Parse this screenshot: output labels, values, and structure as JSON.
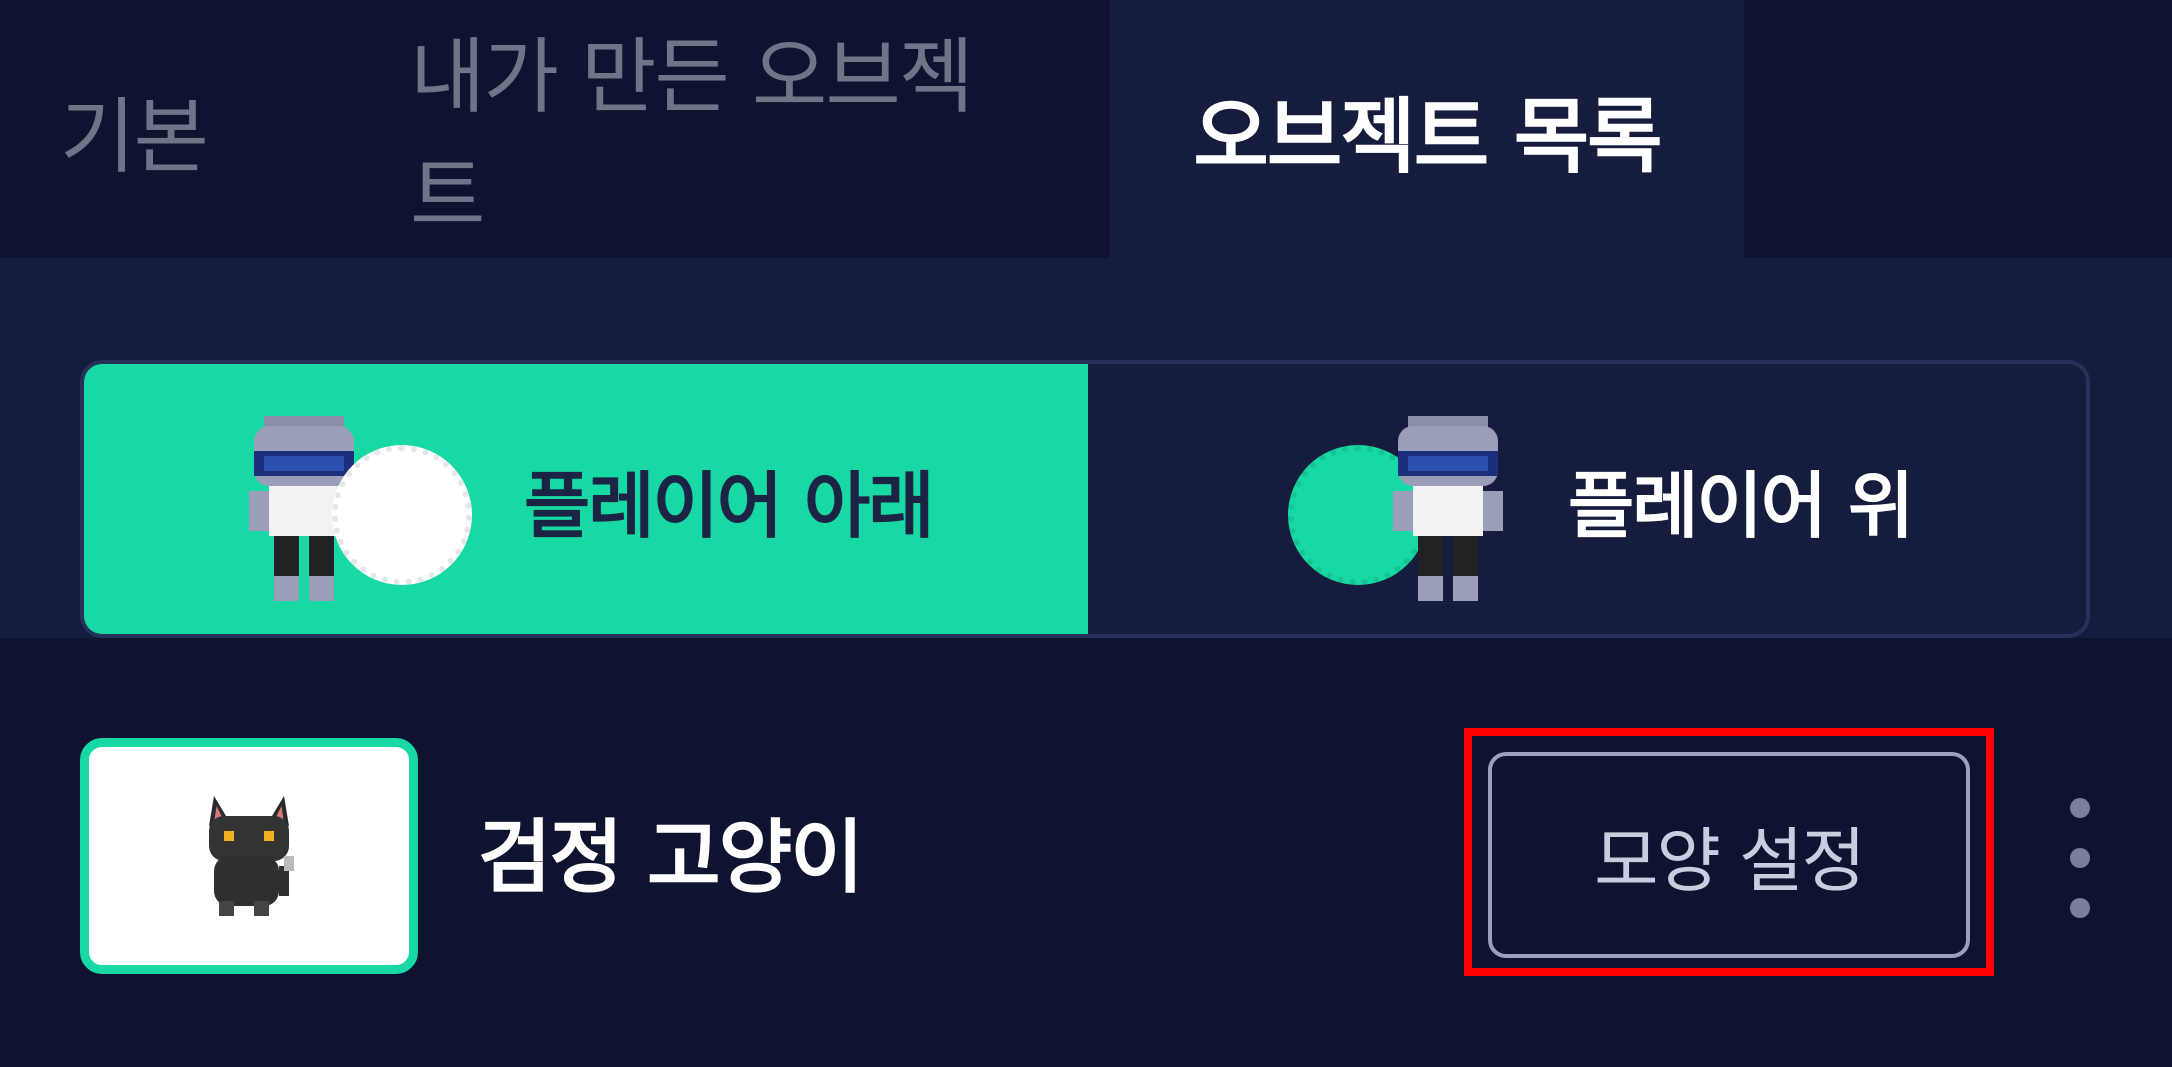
{
  "tabs": [
    {
      "label": "기본",
      "active": false
    },
    {
      "label": "내가 만든 오브젝트",
      "active": false
    },
    {
      "label": "오브젝트 목록",
      "active": true
    }
  ],
  "layer_toggle": {
    "below_label": "플레이어 아래",
    "above_label": "플레이어 위",
    "selected": "below"
  },
  "object": {
    "name": "검정 고양이",
    "shape_button_label": "모양 설정",
    "thumbnail_icon": "black-cat-icon"
  },
  "colors": {
    "accent": "#18d9a3",
    "background": "#0e1430",
    "panel": "#151c3d",
    "highlight": "#ff0000"
  }
}
